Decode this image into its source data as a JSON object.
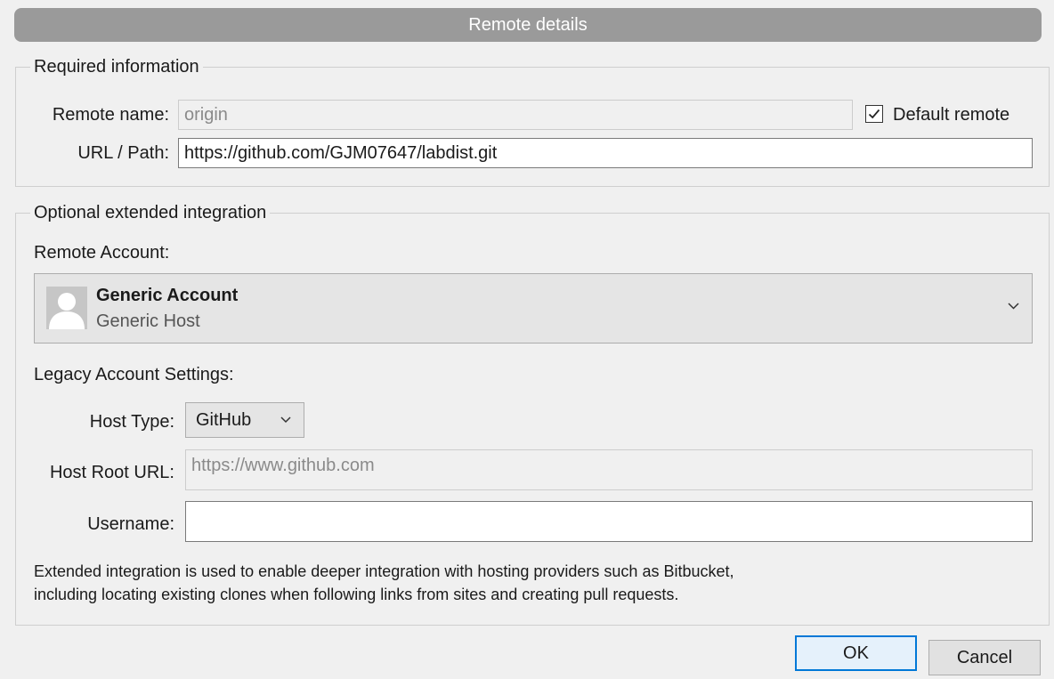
{
  "dialog": {
    "title": "Remote details",
    "accent_color": "#0078d7"
  },
  "required": {
    "legend": "Required information",
    "remote_name_label": "Remote name:",
    "remote_name_value": "origin",
    "default_remote_label": "Default remote",
    "default_remote_checked": true,
    "url_label": "URL / Path:",
    "url_value": "https://github.com/GJM07647/labdist.git"
  },
  "optional": {
    "legend": "Optional extended integration",
    "remote_account_label": "Remote Account:",
    "account": {
      "name": "Generic Account",
      "host": "Generic Host",
      "icon": "user-avatar-icon"
    },
    "legacy_label": "Legacy Account Settings:",
    "host_type_label": "Host Type:",
    "host_type_value": "GitHub",
    "host_root_label": "Host Root URL:",
    "host_root_value": "https://www.github.com",
    "username_label": "Username:",
    "username_value": "",
    "description_lines": [
      "Extended integration is used to enable deeper integration with hosting providers such as Bitbucket,",
      "including locating existing clones when following links from sites and creating pull requests."
    ]
  },
  "buttons": {
    "ok": "OK",
    "cancel": "Cancel"
  }
}
